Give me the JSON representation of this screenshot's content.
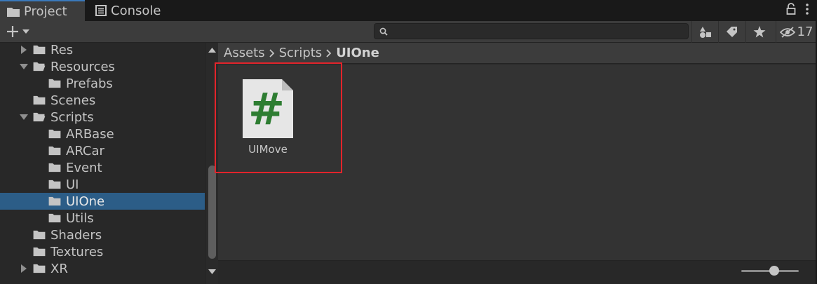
{
  "tabs": [
    {
      "label": "Project",
      "icon": "folder-icon",
      "active": true
    },
    {
      "label": "Console",
      "icon": "console-icon",
      "active": false
    }
  ],
  "toolbar": {
    "search_placeholder": "",
    "hidden_count": "17"
  },
  "tree": [
    {
      "label": "Res",
      "depth": 1,
      "expanded": false,
      "has_children": true
    },
    {
      "label": "Resources",
      "depth": 1,
      "expanded": true,
      "has_children": true
    },
    {
      "label": "Prefabs",
      "depth": 2,
      "has_children": false
    },
    {
      "label": "Scenes",
      "depth": 1,
      "has_children": false
    },
    {
      "label": "Scripts",
      "depth": 1,
      "expanded": true,
      "has_children": true
    },
    {
      "label": "ARBase",
      "depth": 2,
      "has_children": false
    },
    {
      "label": "ARCar",
      "depth": 2,
      "has_children": false
    },
    {
      "label": "Event",
      "depth": 2,
      "has_children": false
    },
    {
      "label": "UI",
      "depth": 2,
      "has_children": false
    },
    {
      "label": "UIOne",
      "depth": 2,
      "has_children": false,
      "selected": true
    },
    {
      "label": "Utils",
      "depth": 2,
      "has_children": false
    },
    {
      "label": "Shaders",
      "depth": 1,
      "has_children": false
    },
    {
      "label": "Textures",
      "depth": 1,
      "has_children": false
    },
    {
      "label": "XR",
      "depth": 1,
      "expanded": false,
      "has_children": true
    }
  ],
  "breadcrumb": [
    "Assets",
    "Scripts",
    "UIOne"
  ],
  "assets": [
    {
      "name": "UIMove",
      "icon": "csharp-script-icon",
      "glyph": "#"
    }
  ],
  "colors": {
    "selection": "#2c5d87",
    "highlight_box": "#e3242b",
    "script_glyph": "#2e7d32"
  }
}
